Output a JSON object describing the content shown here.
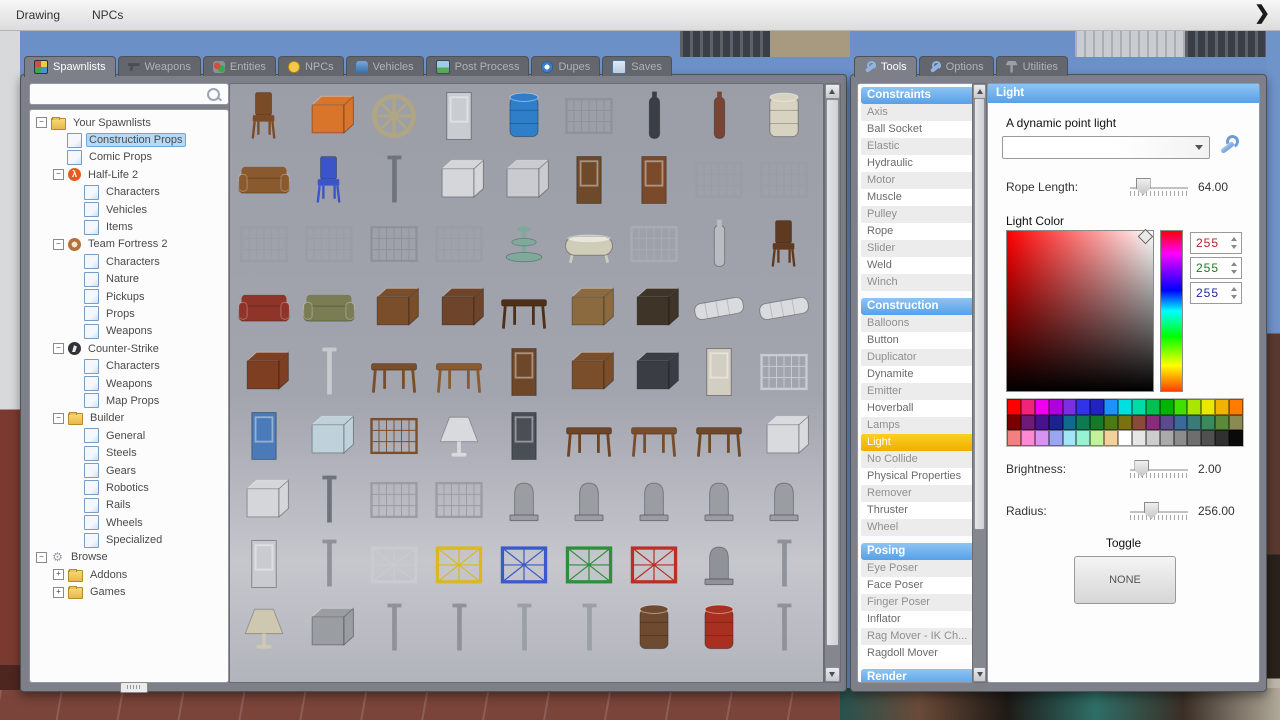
{
  "menu_bar": {
    "items": [
      "Drawing",
      "NPCs"
    ],
    "expand_icon": "❯"
  },
  "left_window": {
    "tabs": [
      {
        "label": "Spawnlists",
        "icon": "spawnlists-icon",
        "active": true
      },
      {
        "label": "Weapons",
        "icon": "weapons-icon",
        "active": false
      },
      {
        "label": "Entities",
        "icon": "entities-icon",
        "active": false
      },
      {
        "label": "NPCs",
        "icon": "npcs-icon",
        "active": false
      },
      {
        "label": "Vehicles",
        "icon": "vehicles-icon",
        "active": false
      },
      {
        "label": "Post Process",
        "icon": "postprocess-icon",
        "active": false
      },
      {
        "label": "Dupes",
        "icon": "dupes-icon",
        "active": false
      },
      {
        "label": "Saves",
        "icon": "saves-icon",
        "active": false
      }
    ],
    "search": {
      "value": "",
      "placeholder": ""
    },
    "tree": [
      {
        "label": "Your Spawnlists",
        "depth": 0,
        "icon": "folder",
        "expander": "-"
      },
      {
        "label": "Construction Props",
        "depth": 1,
        "icon": "page",
        "selected": true
      },
      {
        "label": "Comic Props",
        "depth": 1,
        "icon": "page"
      },
      {
        "label": "Half-Life 2",
        "depth": 1,
        "icon": "hl2",
        "expander": "-"
      },
      {
        "label": "Characters",
        "depth": 2,
        "icon": "page"
      },
      {
        "label": "Vehicles",
        "depth": 2,
        "icon": "page"
      },
      {
        "label": "Items",
        "depth": 2,
        "icon": "page"
      },
      {
        "label": "Team Fortress 2",
        "depth": 1,
        "icon": "tf2",
        "expander": "-"
      },
      {
        "label": "Characters",
        "depth": 2,
        "icon": "page"
      },
      {
        "label": "Nature",
        "depth": 2,
        "icon": "page"
      },
      {
        "label": "Pickups",
        "depth": 2,
        "icon": "page"
      },
      {
        "label": "Props",
        "depth": 2,
        "icon": "page"
      },
      {
        "label": "Weapons",
        "depth": 2,
        "icon": "page"
      },
      {
        "label": "Counter-Strike",
        "depth": 1,
        "icon": "cs",
        "expander": "-"
      },
      {
        "label": "Characters",
        "depth": 2,
        "icon": "page"
      },
      {
        "label": "Weapons",
        "depth": 2,
        "icon": "page"
      },
      {
        "label": "Map Props",
        "depth": 2,
        "icon": "page"
      },
      {
        "label": "Builder",
        "depth": 1,
        "icon": "folder",
        "expander": "-"
      },
      {
        "label": "General",
        "depth": 2,
        "icon": "page"
      },
      {
        "label": "Steels",
        "depth": 2,
        "icon": "page"
      },
      {
        "label": "Gears",
        "depth": 2,
        "icon": "page"
      },
      {
        "label": "Robotics",
        "depth": 2,
        "icon": "page"
      },
      {
        "label": "Rails",
        "depth": 2,
        "icon": "page"
      },
      {
        "label": "Wheels",
        "depth": 2,
        "icon": "page"
      },
      {
        "label": "Specialized",
        "depth": 2,
        "icon": "page"
      },
      {
        "label": "Browse",
        "depth": 0,
        "icon": "gear",
        "expander": "-"
      },
      {
        "label": "Addons",
        "depth": 1,
        "icon": "folder",
        "expander": "+"
      },
      {
        "label": "Games",
        "depth": 1,
        "icon": "folder",
        "expander": "+"
      }
    ],
    "props": [
      {
        "name": "bar-stool",
        "shape": "chair",
        "color": "#7b4a26"
      },
      {
        "name": "cable-spools",
        "shape": "box",
        "color": "#d9742b"
      },
      {
        "name": "old-wheel",
        "shape": "wheel",
        "color": "#b0a684"
      },
      {
        "name": "metal-door",
        "shape": "door",
        "color": "#c9cdd2"
      },
      {
        "name": "plastic-barrel",
        "shape": "barrel",
        "color": "#2e7ec9"
      },
      {
        "name": "jail-bars",
        "shape": "fence",
        "color": "#8f9298"
      },
      {
        "name": "gas-canister",
        "shape": "cylinder",
        "color": "#3a3f46"
      },
      {
        "name": "rusty-pipe",
        "shape": "cylinder",
        "color": "#7a4434"
      },
      {
        "name": "propane-tank",
        "shape": "barrel",
        "color": "#d8d2c0"
      },
      {
        "name": "wood-bench",
        "shape": "sofa",
        "color": "#8a5a2e"
      },
      {
        "name": "school-chair",
        "shape": "chair",
        "color": "#3b55c8"
      },
      {
        "name": "lamp-post",
        "shape": "pole",
        "color": "#6f747c"
      },
      {
        "name": "road-barrier",
        "shape": "box",
        "color": "#d4d6da"
      },
      {
        "name": "shelf",
        "shape": "box",
        "color": "#c9cbd0"
      },
      {
        "name": "wood-door",
        "shape": "door",
        "color": "#6e4a2a"
      },
      {
        "name": "door-frame",
        "shape": "door",
        "color": "#7a4a2a"
      },
      {
        "name": "wire-fence-a",
        "shape": "fence",
        "color": "#9a9da4"
      },
      {
        "name": "wire-fence-b",
        "shape": "fence",
        "color": "#9a9da4"
      },
      {
        "name": "wire-fence-c",
        "shape": "fence",
        "color": "#9a9da4"
      },
      {
        "name": "wire-fence-d",
        "shape": "fence",
        "color": "#9a9da4"
      },
      {
        "name": "wire-gate",
        "shape": "fence",
        "color": "#8f9298"
      },
      {
        "name": "wire-fence-e",
        "shape": "fence",
        "color": "#9a9da4"
      },
      {
        "name": "fountain",
        "shape": "fountain",
        "color": "#7fa99a"
      },
      {
        "name": "bathtub",
        "shape": "tub",
        "color": "#cfcdb8"
      },
      {
        "name": "bed-frame",
        "shape": "fence",
        "color": "#a9acb2"
      },
      {
        "name": "water-heater",
        "shape": "cylinder",
        "color": "#b9bcc0"
      },
      {
        "name": "wood-chair",
        "shape": "chair",
        "color": "#5e3a20"
      },
      {
        "name": "sofa-red",
        "shape": "sofa",
        "color": "#8e3428"
      },
      {
        "name": "sofa-green",
        "shape": "sofa",
        "color": "#7a7c54"
      },
      {
        "name": "dresser",
        "shape": "box",
        "color": "#7a4e2a"
      },
      {
        "name": "chest-drawers",
        "shape": "box",
        "color": "#6e452a"
      },
      {
        "name": "dark-table",
        "shape": "table",
        "color": "#4e3018"
      },
      {
        "name": "wood-crate",
        "shape": "box",
        "color": "#8a6a3e"
      },
      {
        "name": "dark-bin",
        "shape": "box",
        "color": "#3e3428"
      },
      {
        "name": "mattress-a",
        "shape": "mattress",
        "color": "#d9dbde"
      },
      {
        "name": "mattress-b",
        "shape": "mattress",
        "color": "#d9dbde"
      },
      {
        "name": "red-dresser",
        "shape": "box",
        "color": "#7e3e22"
      },
      {
        "name": "flag-pole",
        "shape": "pole",
        "color": "#c8cace"
      },
      {
        "name": "side-table",
        "shape": "table",
        "color": "#7a4e2a"
      },
      {
        "name": "wood-stand",
        "shape": "table",
        "color": "#8a5a30"
      },
      {
        "name": "cabinet",
        "shape": "door",
        "color": "#6e4628"
      },
      {
        "name": "small-cabinet",
        "shape": "box",
        "color": "#7a4e2a"
      },
      {
        "name": "stove",
        "shape": "box",
        "color": "#3a3e44"
      },
      {
        "name": "fridge",
        "shape": "door",
        "color": "#d2cfc2"
      },
      {
        "name": "radiator",
        "shape": "fence",
        "color": "#c9ccd1"
      },
      {
        "name": "vending-machine",
        "shape": "door",
        "color": "#4a7ab8"
      },
      {
        "name": "glass-pane",
        "shape": "box",
        "color": "#bfd2dc"
      },
      {
        "name": "coat-rack",
        "shape": "fence",
        "color": "#7a4e2a"
      },
      {
        "name": "sink",
        "shape": "lamp",
        "color": "#d8dadd"
      },
      {
        "name": "locker-dark",
        "shape": "door",
        "color": "#4a4e55"
      },
      {
        "name": "round-table",
        "shape": "table",
        "color": "#6e4426"
      },
      {
        "name": "desk",
        "shape": "table",
        "color": "#7a4e2a"
      },
      {
        "name": "small-table",
        "shape": "table",
        "color": "#6e4828"
      },
      {
        "name": "gloves",
        "shape": "box",
        "color": "#d8dadd"
      },
      {
        "name": "washer",
        "shape": "box",
        "color": "#d4d6d9"
      },
      {
        "name": "street-lamp",
        "shape": "pole",
        "color": "#6f747c"
      },
      {
        "name": "fence-small-a",
        "shape": "fence",
        "color": "#9a9da4"
      },
      {
        "name": "fence-small-b",
        "shape": "fence",
        "color": "#9a9da4"
      },
      {
        "name": "gravestone-a",
        "shape": "stone",
        "color": "#9a9da2"
      },
      {
        "name": "gravestone-b",
        "shape": "stone",
        "color": "#9a9da2"
      },
      {
        "name": "gravestone-c",
        "shape": "stone",
        "color": "#9a9da2"
      },
      {
        "name": "gravestone-d",
        "shape": "stone",
        "color": "#9a9da2"
      },
      {
        "name": "gravestone-e",
        "shape": "stone",
        "color": "#9a9da2"
      },
      {
        "name": "locker-white",
        "shape": "door",
        "color": "#c9cbd0"
      },
      {
        "name": "cross-marker",
        "shape": "pole",
        "color": "#8f9298"
      },
      {
        "name": "cage-white",
        "shape": "cage",
        "color": "#c9cbd0"
      },
      {
        "name": "cage-yellow",
        "shape": "cage",
        "color": "#d9b820"
      },
      {
        "name": "cage-blue",
        "shape": "cage",
        "color": "#3a5ac8"
      },
      {
        "name": "cage-green",
        "shape": "cage",
        "color": "#2e8e3a"
      },
      {
        "name": "cage-red",
        "shape": "cage",
        "color": "#b83028"
      },
      {
        "name": "monument",
        "shape": "stone",
        "color": "#8f9298"
      },
      {
        "name": "metal-pole",
        "shape": "pole",
        "color": "#8f9298"
      },
      {
        "name": "lamp-shade",
        "shape": "lamp",
        "color": "#cfc8b0"
      },
      {
        "name": "lockers",
        "shape": "box",
        "color": "#9a9da2"
      },
      {
        "name": "truss-a",
        "shape": "pole",
        "color": "#8f9298"
      },
      {
        "name": "truss-b",
        "shape": "pole",
        "color": "#8f9298"
      },
      {
        "name": "faucet-a",
        "shape": "pole",
        "color": "#9aa0a6"
      },
      {
        "name": "faucet-b",
        "shape": "pole",
        "color": "#9aa0a6"
      },
      {
        "name": "oil-drum",
        "shape": "barrel",
        "color": "#6e4a30"
      },
      {
        "name": "red-barrel",
        "shape": "barrel",
        "color": "#a83020"
      },
      {
        "name": "thin-pole",
        "shape": "pole",
        "color": "#8f9298"
      }
    ]
  },
  "right_window": {
    "tabs": [
      {
        "label": "Tools",
        "icon": "wrench-icon",
        "active": true
      },
      {
        "label": "Options",
        "icon": "wrench-icon",
        "active": false
      },
      {
        "label": "Utilities",
        "icon": "utilities-icon",
        "active": false
      }
    ],
    "tool_sections": [
      {
        "header": "Constraints",
        "items": [
          "Axis",
          "Ball Socket",
          "Elastic",
          "Hydraulic",
          "Motor",
          "Muscle",
          "Pulley",
          "Rope",
          "Slider",
          "Weld",
          "Winch"
        ],
        "selected": ""
      },
      {
        "header": "Construction",
        "items": [
          "Balloons",
          "Button",
          "Duplicator",
          "Dynamite",
          "Emitter",
          "Hoverball",
          "Lamps",
          "Light",
          "No Collide",
          "Physical Properties",
          "Remover",
          "Thruster",
          "Wheel"
        ],
        "selected": "Light"
      },
      {
        "header": "Posing",
        "items": [
          "Eye Poser",
          "Face Poser",
          "Finger Poser",
          "Inflator",
          "Rag Mover - IK Ch...",
          "Ragdoll Mover"
        ],
        "selected": ""
      },
      {
        "header": "Render",
        "items": [],
        "selected": ""
      }
    ],
    "panel": {
      "title": "Light",
      "description": "A dynamic point light",
      "preset_value": "",
      "rope": {
        "label": "Rope Length:",
        "value": "64.00",
        "pct": 20
      },
      "brightness": {
        "label": "Brightness:",
        "value": "2.00",
        "pct": 18
      },
      "radius": {
        "label": "Radius:",
        "value": "256.00",
        "pct": 34
      },
      "light_color_label": "Light Color",
      "rgb": [
        {
          "channel": "red",
          "value": "255",
          "color": "#b22222"
        },
        {
          "channel": "green",
          "value": "255",
          "color": "#1e7a1e"
        },
        {
          "channel": "blue",
          "value": "255",
          "color": "#22259a"
        }
      ],
      "palette": [
        [
          "#ff0000",
          "#f0257a",
          "#ee00ee",
          "#ae00dc",
          "#7b2fe0",
          "#3232e6",
          "#2222be",
          "#1e90ff",
          "#00e0e0",
          "#00dca8",
          "#00c050",
          "#00b400",
          "#40e000",
          "#a8e800",
          "#e8e800",
          "#f0b400",
          "#ff7c00"
        ],
        [
          "#7a0000",
          "#6e1b78",
          "#46128e",
          "#1c2390",
          "#0e6a8e",
          "#0e7a52",
          "#157a28",
          "#4a7a14",
          "#7a7210",
          "#8a4a3a",
          "#8a2a7a",
          "#5a4a8e",
          "#3a6a9a",
          "#3a7a7a",
          "#3a8a5e",
          "#5a8a3a",
          "#8a8a52"
        ],
        [
          "#f28080",
          "#ff8ad2",
          "#d892f2",
          "#9aa6f2",
          "#a0e6f6",
          "#96f2d2",
          "#c2f29a",
          "#f2d29a",
          "#ffffff",
          "#e6e6e6",
          "#cccccc",
          "#aaaaaa",
          "#8c8c8c",
          "#6e6e6e",
          "#505050",
          "#303030",
          "#0a0a0a"
        ]
      ],
      "toggle_label": "Toggle",
      "none_button": "NONE"
    }
  }
}
